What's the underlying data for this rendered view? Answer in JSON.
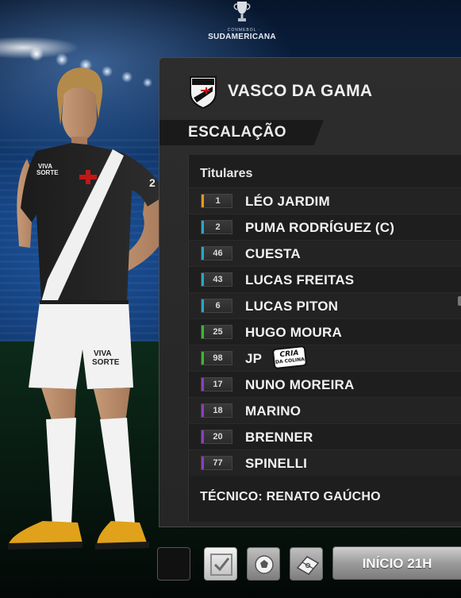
{
  "competition": {
    "logo_small": "· CONMEBOL ·",
    "logo_name": "SUDAMERICANA"
  },
  "club": {
    "name": "VASCO DA GAMA"
  },
  "section": {
    "title": "ESCALAÇÃO"
  },
  "lineup": {
    "heading": "Titulares",
    "players": [
      {
        "number": "1",
        "name": "LÉO JARDIM",
        "color": "#e89a1c"
      },
      {
        "number": "2",
        "name": "PUMA RODRÍGUEZ (C)",
        "color": "#2aa6c8"
      },
      {
        "number": "46",
        "name": "CUESTA",
        "color": "#2aa6c8"
      },
      {
        "number": "43",
        "name": "LUCAS FREITAS",
        "color": "#2aa6c8"
      },
      {
        "number": "6",
        "name": "LUCAS PITON",
        "color": "#2aa6c8"
      },
      {
        "number": "25",
        "name": "HUGO MOURA",
        "color": "#3cb832"
      },
      {
        "number": "98",
        "name": "JP",
        "color": "#3cb832"
      },
      {
        "number": "17",
        "name": "NUNO MOREIRA",
        "color": "#8a3fc0"
      },
      {
        "number": "18",
        "name": "MARINO",
        "color": "#8a3fc0"
      },
      {
        "number": "20",
        "name": "BRENNER",
        "color": "#8a3fc0"
      },
      {
        "number": "77",
        "name": "SPINELLI",
        "color": "#8a3fc0"
      }
    ],
    "badge_top": "CRIA",
    "badge_bottom": "DA COLINA",
    "coach": "TÉCNICO: RENATO GAÚCHO"
  },
  "footer": {
    "start_label": "INÍCIO 21H",
    "icons": [
      "empty-slot",
      "check-icon",
      "ball-icon",
      "pitch-icon"
    ]
  },
  "kit": {
    "shirt_sponsor_1": "VIVA",
    "shirt_sponsor_2": "SORTE",
    "shorts_sponsor_1": "VIVA",
    "shorts_sponsor_2": "SORTE",
    "shirt_number": "2"
  }
}
